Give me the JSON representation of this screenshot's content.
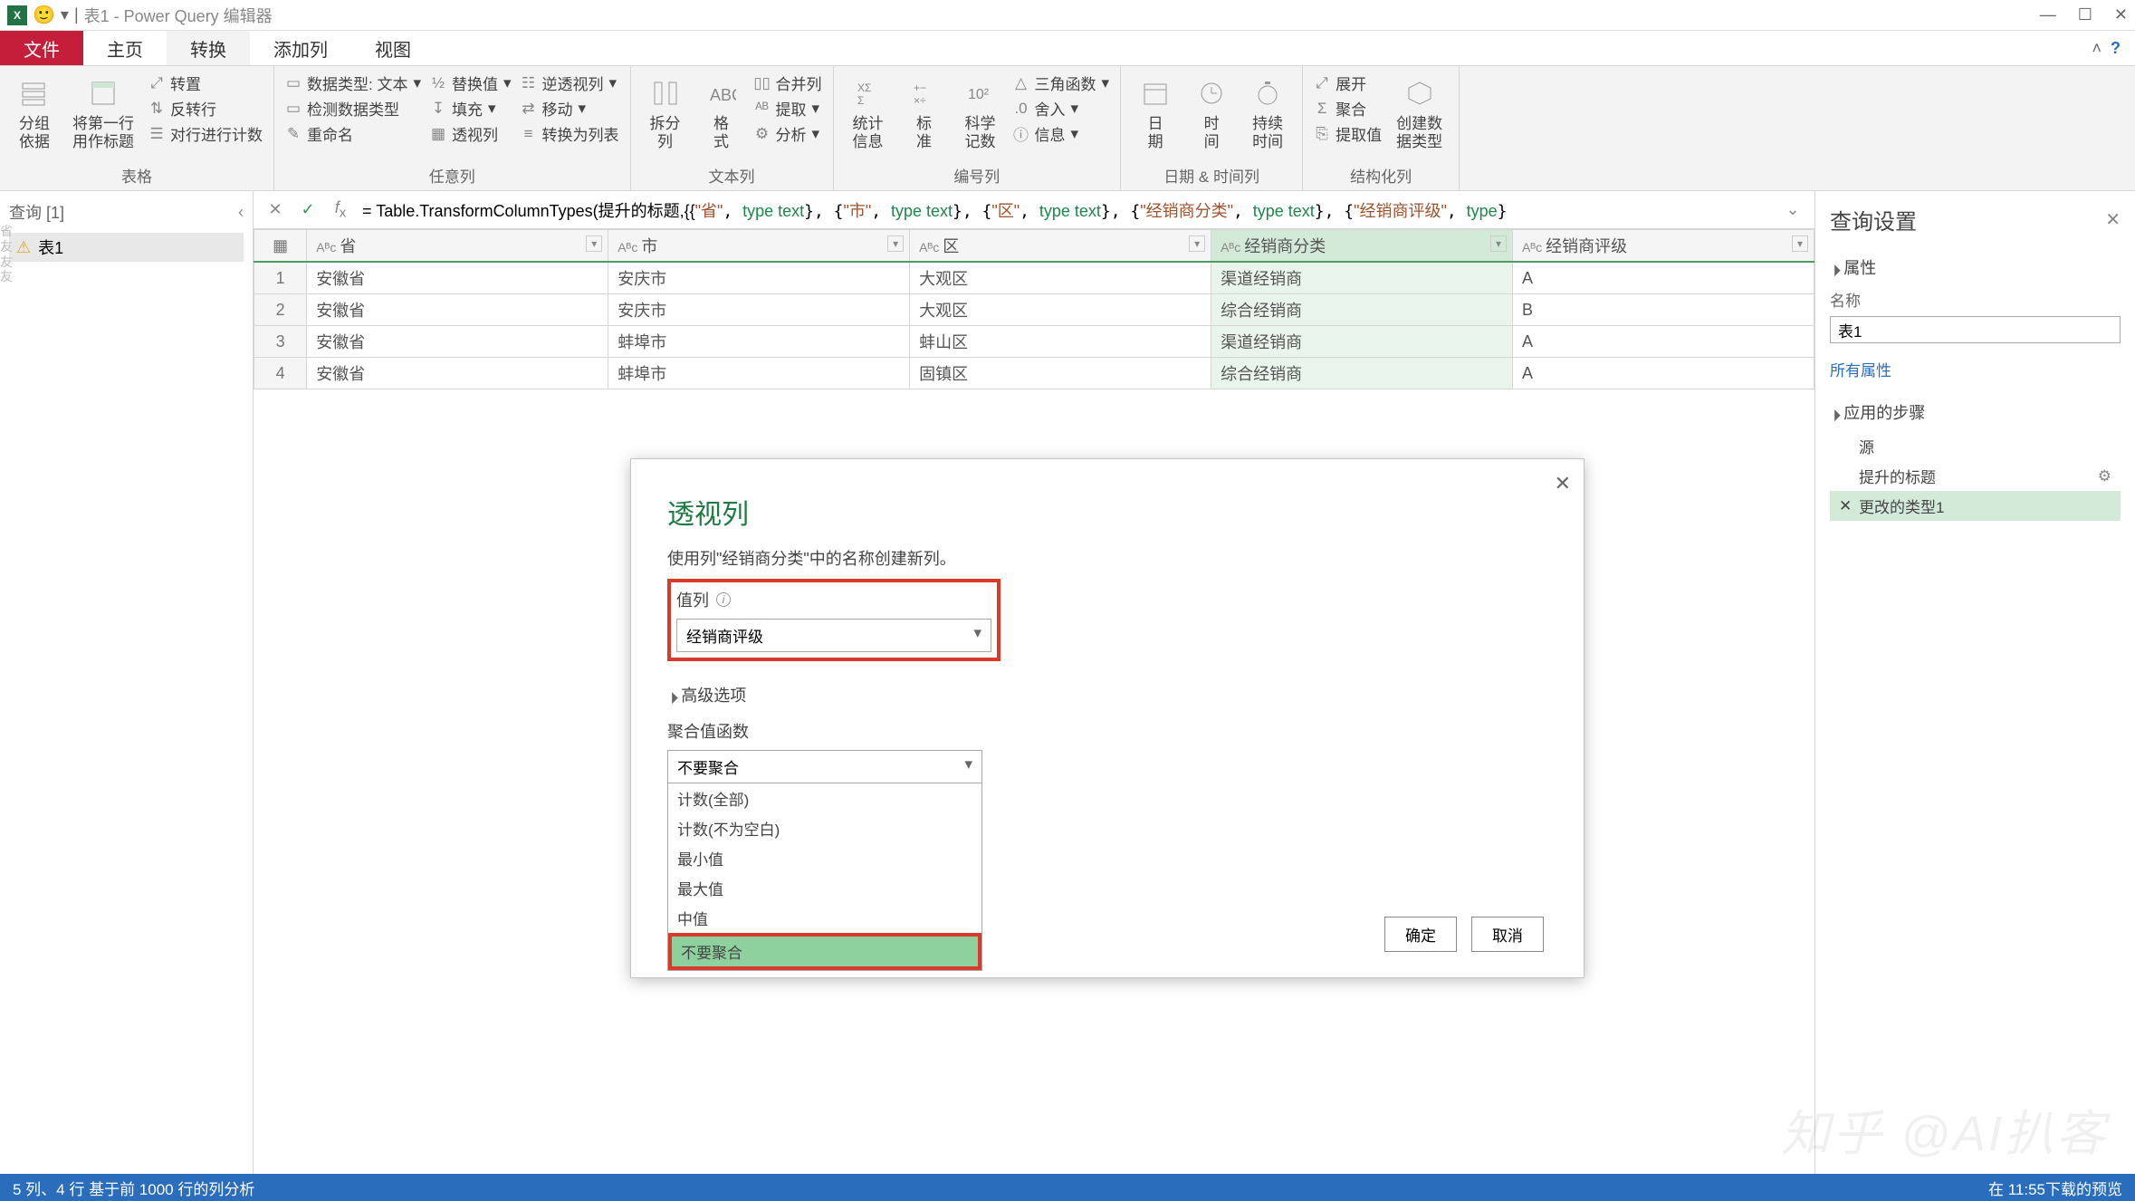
{
  "window": {
    "title": "表1 - Power Query 编辑器",
    "excel_icon_text": "X"
  },
  "tabs": {
    "file": "文件",
    "home": "主页",
    "transform": "转换",
    "addcol": "添加列",
    "view": "视图"
  },
  "ribbon": {
    "groups": {
      "table": {
        "label": "表格",
        "groupby": "分组\n依据",
        "firstrow": "将第一行\n用作标题",
        "sub": [
          "转置",
          "反转行",
          "对行进行计数"
        ]
      },
      "anycol": {
        "label": "任意列",
        "datatype": "数据类型: 文本",
        "detect": "检测数据类型",
        "rename": "重命名",
        "replace": "替换值",
        "fill": "填充",
        "pivot": "透视列",
        "unpivot": "逆透视列",
        "move": "移动",
        "tolist": "转换为列表"
      },
      "textcol": {
        "label": "文本列",
        "split": "拆分\n列",
        "format": "格\n式",
        "sub": [
          "合并列",
          "提取",
          "分析"
        ]
      },
      "numcol": {
        "label": "编号列",
        "stats": "统计\n信息",
        "standard": "标\n准",
        "sci": "科学\n记数",
        "sub": [
          "三角函数",
          "舍入",
          "信息"
        ]
      },
      "datetime": {
        "label": "日期 & 时间列",
        "date": "日\n期",
        "time": "时\n间",
        "duration": "持续\n时间"
      },
      "struct": {
        "label": "结构化列",
        "expand": "展开",
        "aggregate": "聚合",
        "extract": "提取值",
        "create": "创建数\n据类型"
      }
    }
  },
  "left_panel": {
    "title": "查询 [1]",
    "query_name": "表1"
  },
  "formula": {
    "prefix": "= Table.TransformColumnTypes(提升的标题,{{",
    "pairs": [
      {
        "k": "\"省\"",
        "v": "type text"
      },
      {
        "k": "\"市\"",
        "v": "type text"
      },
      {
        "k": "\"区\"",
        "v": "type text"
      },
      {
        "k": "\"经销商分类\"",
        "v": "type text"
      },
      {
        "k": "\"经销商评级\"",
        "v": "type"
      }
    ]
  },
  "grid": {
    "columns": [
      "省",
      "市",
      "区",
      "经销商分类",
      "经销商评级"
    ],
    "selected_col_index": 3,
    "rows": [
      [
        "安徽省",
        "安庆市",
        "大观区",
        "渠道经销商",
        "A"
      ],
      [
        "安徽省",
        "安庆市",
        "大观区",
        "综合经销商",
        "B"
      ],
      [
        "安徽省",
        "蚌埠市",
        "蚌山区",
        "渠道经销商",
        "A"
      ],
      [
        "安徽省",
        "蚌埠市",
        "固镇区",
        "综合经销商",
        "A"
      ]
    ]
  },
  "right_panel": {
    "title": "查询设置",
    "section_props": "属性",
    "name_label": "名称",
    "all_props_link": "所有属性",
    "section_steps": "应用的步骤",
    "steps": [
      {
        "label": "源",
        "selected": false,
        "deletable": false,
        "gear": false
      },
      {
        "label": "提升的标题",
        "selected": false,
        "deletable": false,
        "gear": true
      },
      {
        "label": "更改的类型1",
        "selected": true,
        "deletable": true,
        "gear": false
      }
    ]
  },
  "dialog": {
    "title": "透视列",
    "desc": "使用列\"经销商分类\"中的名称创建新列。",
    "value_col_label": "值列",
    "value_col_selected": "经销商评级",
    "adv_label": "高级选项",
    "agg_label": "聚合值函数",
    "agg_selected": "不要聚合",
    "agg_options": [
      "计数(全部)",
      "计数(不为空白)",
      "最小值",
      "最大值",
      "中值",
      "不要聚合"
    ],
    "agg_highlight_index": 5,
    "ok": "确定",
    "cancel": "取消"
  },
  "statusbar": {
    "left": "5 列、4 行    基于前 1000 行的列分析",
    "right": "在 11:55下载的预览"
  },
  "watermark": "知乎 @AI扒客"
}
